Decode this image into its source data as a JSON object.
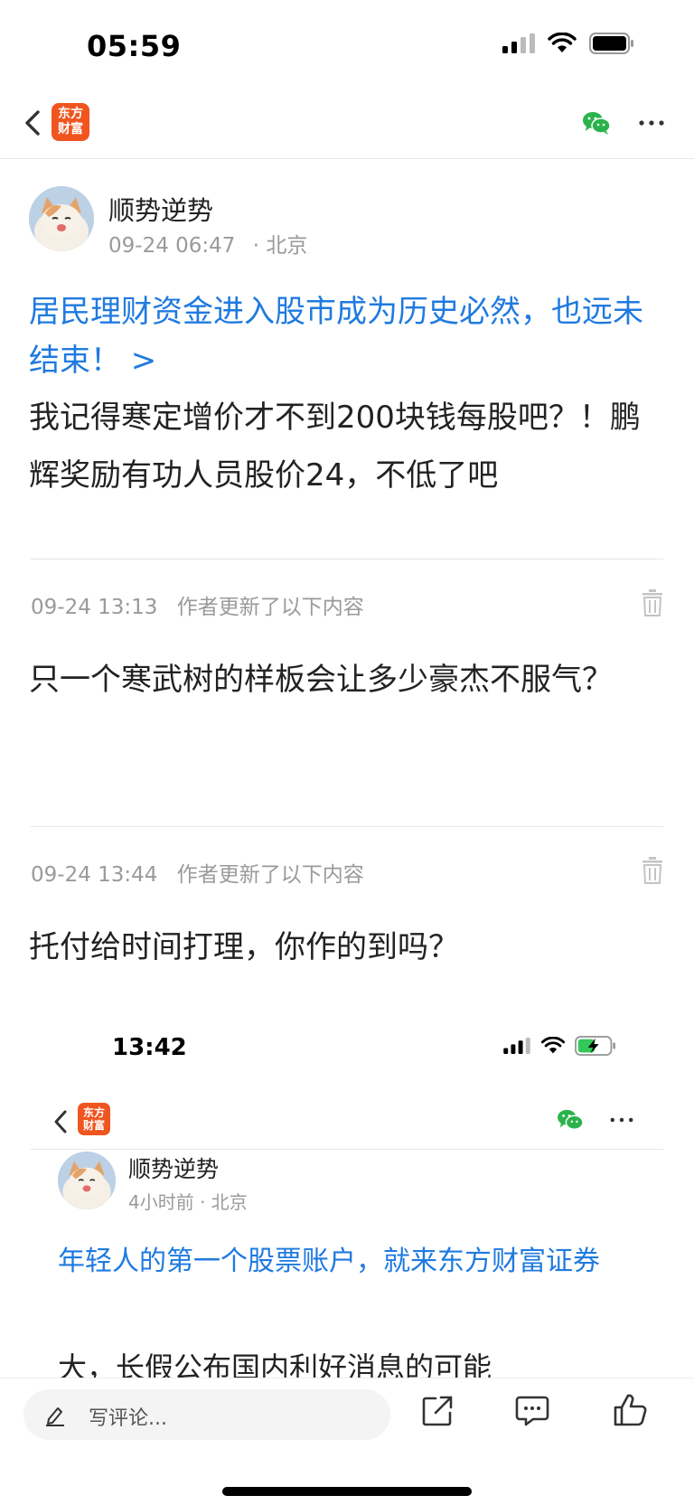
{
  "status_bar": {
    "time": "05:59"
  },
  "nav": {
    "logo_line1": "东方",
    "logo_line2": "财富"
  },
  "post": {
    "author_name": "顺势逆势",
    "date": "09-24 06:47",
    "location": "· 北京",
    "link_title": "居民理财资金进入股市成为历史必然，也远未结束！ >",
    "body": "我记得寒定增价才不到200块钱每股吧？！鹏辉奖励有功人员股价24，不低了吧"
  },
  "updates": [
    {
      "time": "09-24 13:13",
      "label": "作者更新了以下内容",
      "text": "只一个寒武树的样板会让多少豪杰不服气？"
    },
    {
      "time": "09-24 13:44",
      "label": "作者更新了以下内容",
      "text": "托付给时间打理，你作的到吗？"
    }
  ],
  "embed": {
    "time": "13:42",
    "logo_line1": "东方",
    "logo_line2": "财富",
    "author_name": "顺势逆势",
    "meta": "4小时前 · 北京",
    "link_title": "年轻人的第一个股票账户，就来东方财富证券",
    "cut_text": "大，长假公布国内利好消息的可能"
  },
  "bottom_bar": {
    "comment_placeholder": "写评论...",
    "icons": [
      "pen-icon",
      "share-icon",
      "comment-icon",
      "thumbs-up-icon"
    ]
  },
  "colors": {
    "link": "#1f7ae0",
    "brand": "#f0551f",
    "wechat": "#2bb24c"
  }
}
